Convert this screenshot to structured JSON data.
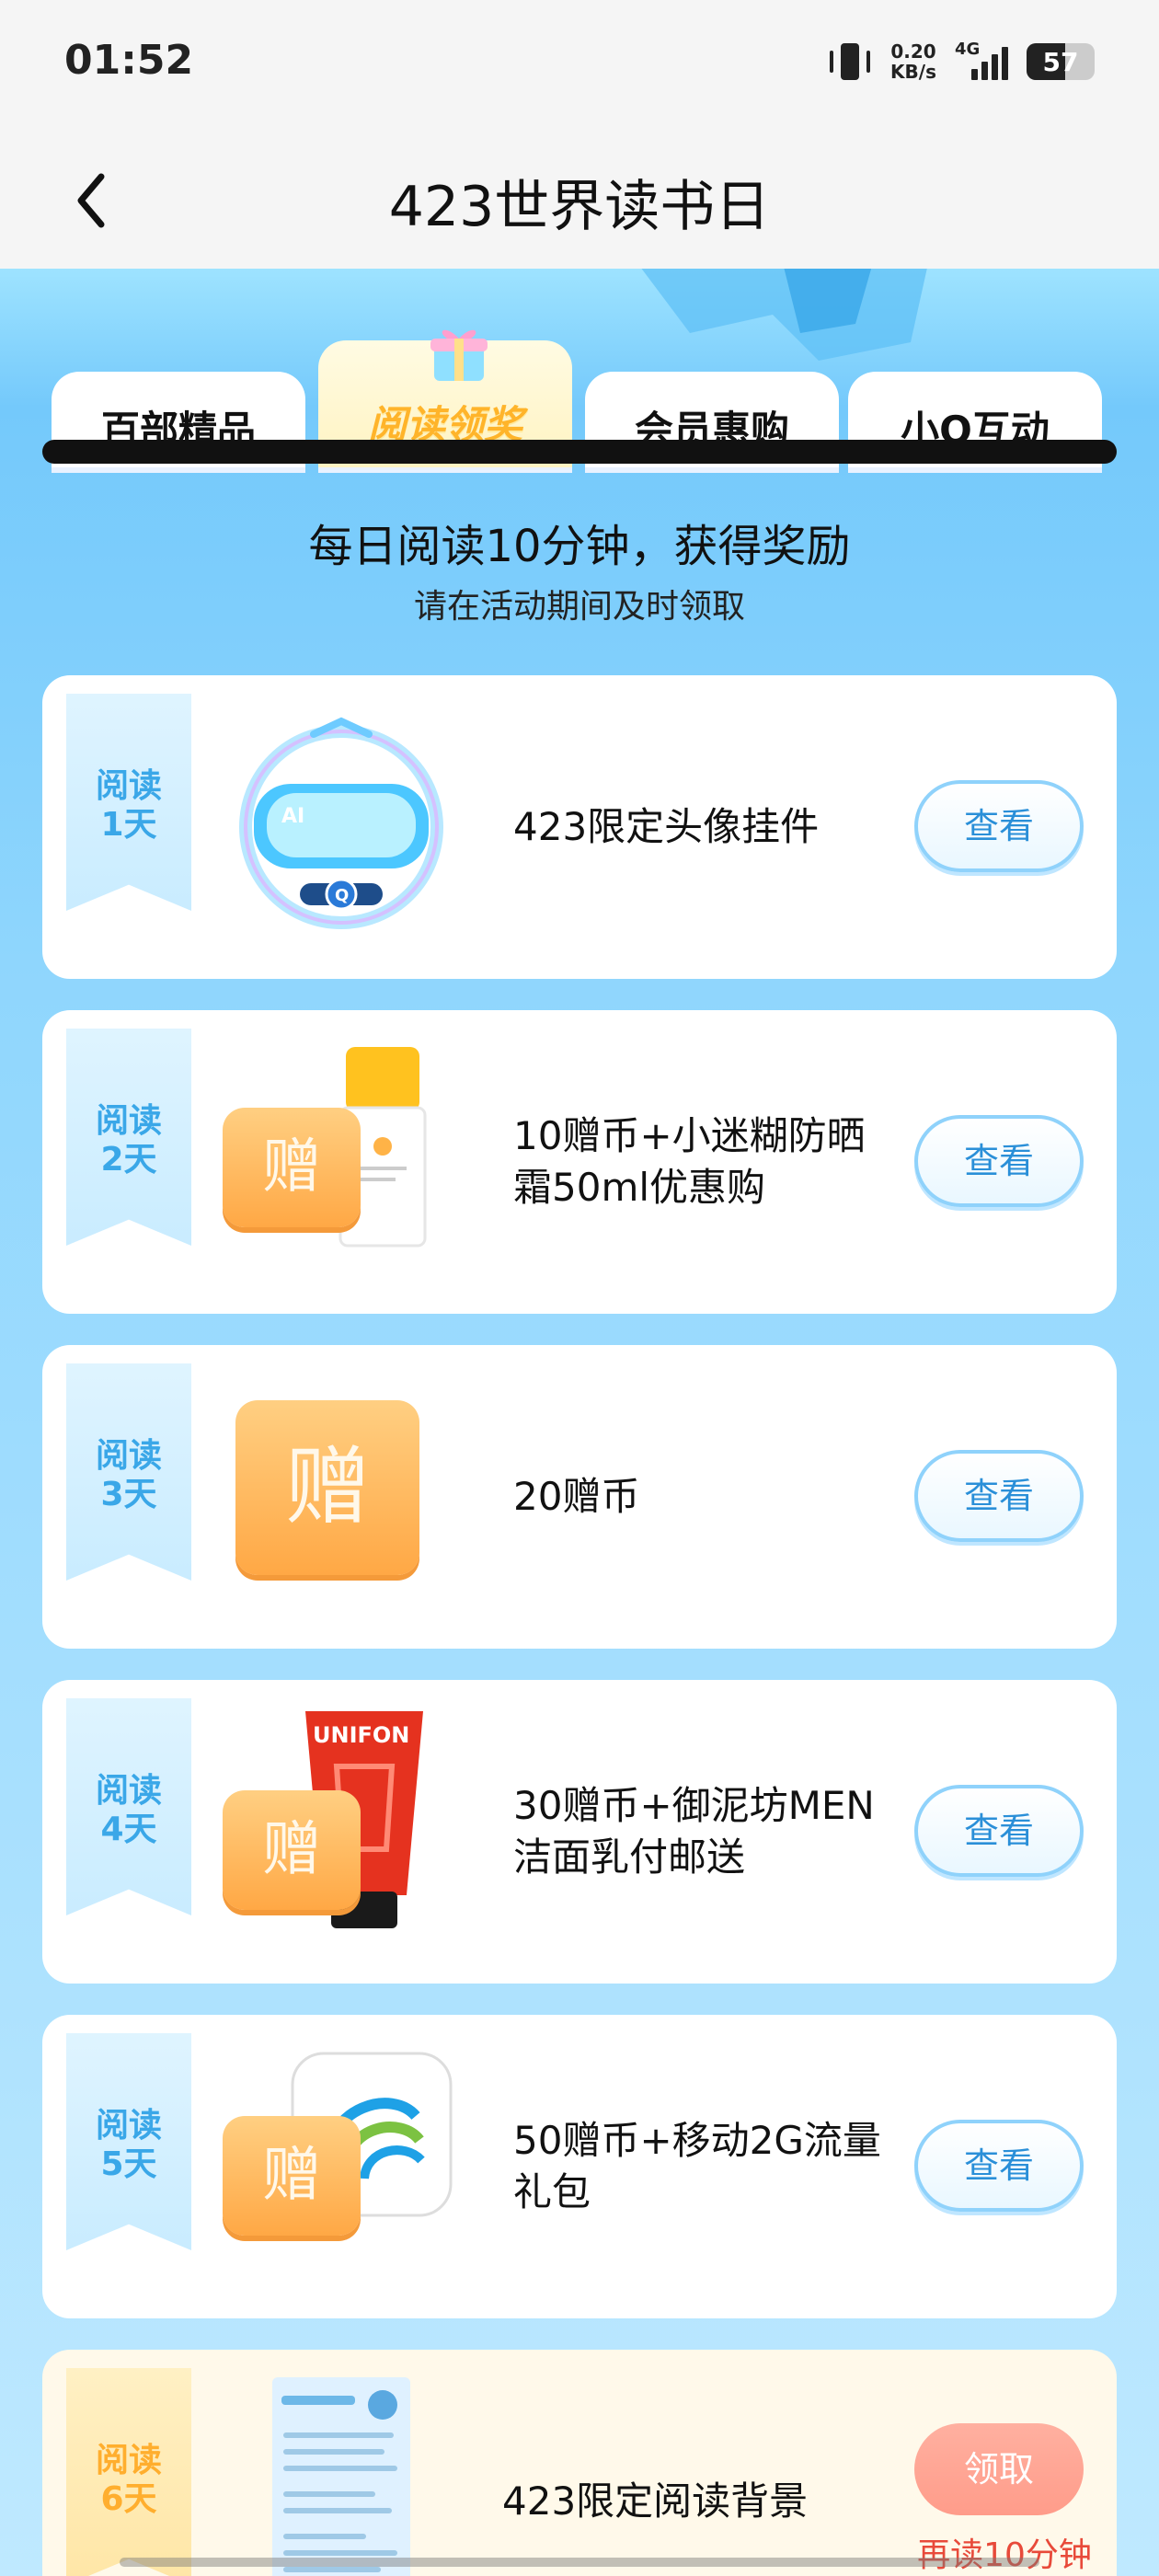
{
  "status": {
    "time": "01:52",
    "net_speed_value": "0.20",
    "net_speed_unit": "KB/s",
    "network": "4G",
    "battery": "57",
    "battery_level": 0.57
  },
  "nav": {
    "title": "423世界读书日"
  },
  "tabs": [
    {
      "label": "百部精品"
    },
    {
      "label": "阅读领奖"
    },
    {
      "label": "会员惠购"
    },
    {
      "label": "小Q互动"
    }
  ],
  "active_tab_index": 1,
  "headline": "每日阅读10分钟，获得奖励",
  "subline": "请在活动期间及时领取",
  "rewards": [
    {
      "day_line1": "阅读",
      "day_line2": "1天",
      "title": "423限定头像挂件",
      "button": "查看",
      "thumb_icon": "ai-goggles-avatar-frame"
    },
    {
      "day_line1": "阅读",
      "day_line2": "2天",
      "title": "10赠币+小迷糊防晒霜50ml优惠购",
      "button": "查看",
      "thumb_icon": "gift-coin-sunscreen"
    },
    {
      "day_line1": "阅读",
      "day_line2": "3天",
      "title": "20赠币",
      "button": "查看",
      "thumb_icon": "gift-coin"
    },
    {
      "day_line1": "阅读",
      "day_line2": "4天",
      "title": "30赠币+御泥坊MEN洁面乳付邮送",
      "button": "查看",
      "thumb_icon": "gift-coin-cleanser"
    },
    {
      "day_line1": "阅读",
      "day_line2": "5天",
      "title": "50赠币+移动2G流量礼包",
      "button": "查看",
      "thumb_icon": "gift-coin-china-mobile"
    },
    {
      "day_line1": "阅读",
      "day_line2": "6天",
      "title": "423限定阅读背景",
      "button": "领取",
      "note": "再读10分钟",
      "thumb_icon": "reading-background-preview"
    }
  ],
  "gift_char": "赠",
  "product_texts": {
    "cleanser_brand": "UNIFON"
  },
  "colors": {
    "accent_blue": "#2a8fd8",
    "tag_blue": "#3aa7e8",
    "tag_gold": "#ffae2e",
    "claim_red": "#e84a3a"
  }
}
